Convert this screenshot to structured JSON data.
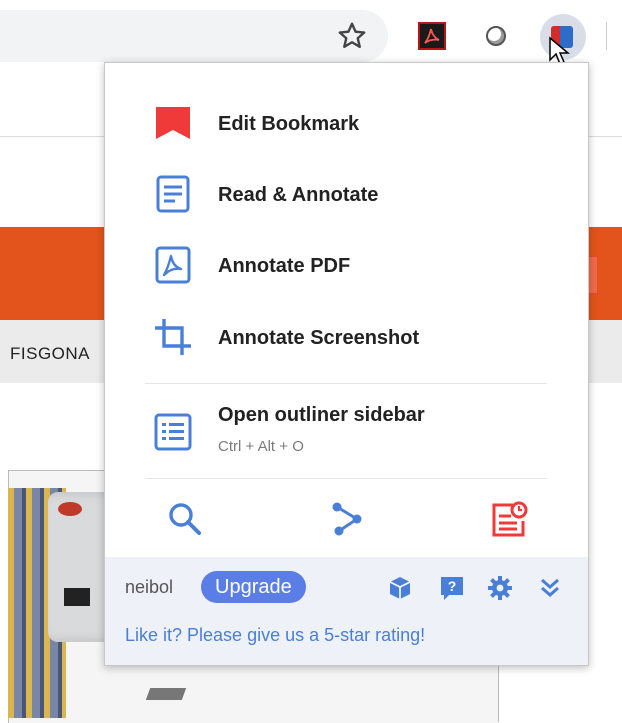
{
  "background": {
    "site_nav_text": "FISGONA"
  },
  "menu": {
    "items": [
      {
        "label": "Edit Bookmark"
      },
      {
        "label": "Read & Annotate"
      },
      {
        "label": "Annotate PDF"
      },
      {
        "label": "Annotate Screenshot"
      },
      {
        "label": "Open outliner sidebar",
        "shortcut": "Ctrl + Alt + O"
      }
    ]
  },
  "footer": {
    "username": "neibol",
    "upgrade_label": "Upgrade",
    "rating_text": "Like it? Please give us a 5-star rating!"
  },
  "colors": {
    "accent_blue": "#4a7fd8",
    "bookmark_red": "#f03a3a",
    "orange_band": "#e2541b",
    "upgrade_bg": "#5b7de6",
    "footer_bg": "#eef1f7"
  },
  "icons": {
    "toolbar": [
      "star-icon",
      "acrobat-extension-icon",
      "circle-extension-icon",
      "hypothesis-extension-icon"
    ],
    "menu": [
      "bookmark-icon",
      "document-icon",
      "pdf-icon",
      "crop-icon",
      "outline-list-icon"
    ],
    "bottom_row": [
      "search-icon",
      "share-icon",
      "reminder-icon"
    ],
    "footer": [
      "cube-icon",
      "help-icon",
      "gear-icon",
      "chevron-double-down-icon"
    ]
  }
}
